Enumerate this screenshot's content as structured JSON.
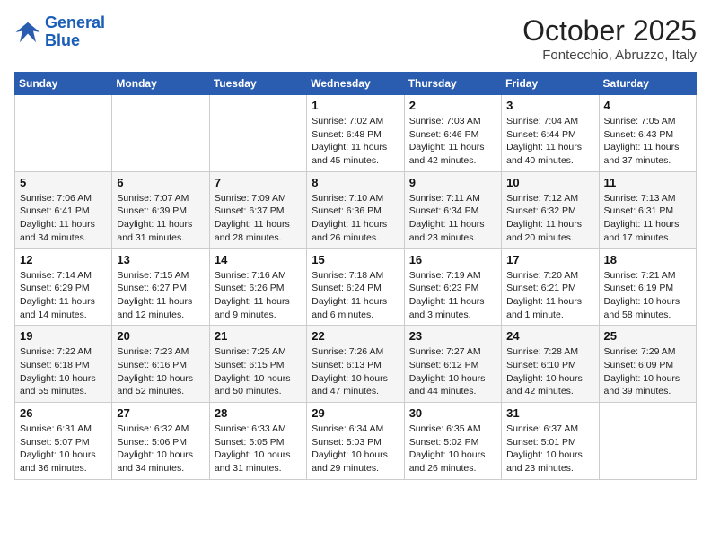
{
  "header": {
    "logo_line1": "General",
    "logo_line2": "Blue",
    "month": "October 2025",
    "location": "Fontecchio, Abruzzo, Italy"
  },
  "weekdays": [
    "Sunday",
    "Monday",
    "Tuesday",
    "Wednesday",
    "Thursday",
    "Friday",
    "Saturday"
  ],
  "weeks": [
    [
      {
        "day": "",
        "detail": ""
      },
      {
        "day": "",
        "detail": ""
      },
      {
        "day": "",
        "detail": ""
      },
      {
        "day": "1",
        "detail": "Sunrise: 7:02 AM\nSunset: 6:48 PM\nDaylight: 11 hours\nand 45 minutes."
      },
      {
        "day": "2",
        "detail": "Sunrise: 7:03 AM\nSunset: 6:46 PM\nDaylight: 11 hours\nand 42 minutes."
      },
      {
        "day": "3",
        "detail": "Sunrise: 7:04 AM\nSunset: 6:44 PM\nDaylight: 11 hours\nand 40 minutes."
      },
      {
        "day": "4",
        "detail": "Sunrise: 7:05 AM\nSunset: 6:43 PM\nDaylight: 11 hours\nand 37 minutes."
      }
    ],
    [
      {
        "day": "5",
        "detail": "Sunrise: 7:06 AM\nSunset: 6:41 PM\nDaylight: 11 hours\nand 34 minutes."
      },
      {
        "day": "6",
        "detail": "Sunrise: 7:07 AM\nSunset: 6:39 PM\nDaylight: 11 hours\nand 31 minutes."
      },
      {
        "day": "7",
        "detail": "Sunrise: 7:09 AM\nSunset: 6:37 PM\nDaylight: 11 hours\nand 28 minutes."
      },
      {
        "day": "8",
        "detail": "Sunrise: 7:10 AM\nSunset: 6:36 PM\nDaylight: 11 hours\nand 26 minutes."
      },
      {
        "day": "9",
        "detail": "Sunrise: 7:11 AM\nSunset: 6:34 PM\nDaylight: 11 hours\nand 23 minutes."
      },
      {
        "day": "10",
        "detail": "Sunrise: 7:12 AM\nSunset: 6:32 PM\nDaylight: 11 hours\nand 20 minutes."
      },
      {
        "day": "11",
        "detail": "Sunrise: 7:13 AM\nSunset: 6:31 PM\nDaylight: 11 hours\nand 17 minutes."
      }
    ],
    [
      {
        "day": "12",
        "detail": "Sunrise: 7:14 AM\nSunset: 6:29 PM\nDaylight: 11 hours\nand 14 minutes."
      },
      {
        "day": "13",
        "detail": "Sunrise: 7:15 AM\nSunset: 6:27 PM\nDaylight: 11 hours\nand 12 minutes."
      },
      {
        "day": "14",
        "detail": "Sunrise: 7:16 AM\nSunset: 6:26 PM\nDaylight: 11 hours\nand 9 minutes."
      },
      {
        "day": "15",
        "detail": "Sunrise: 7:18 AM\nSunset: 6:24 PM\nDaylight: 11 hours\nand 6 minutes."
      },
      {
        "day": "16",
        "detail": "Sunrise: 7:19 AM\nSunset: 6:23 PM\nDaylight: 11 hours\nand 3 minutes."
      },
      {
        "day": "17",
        "detail": "Sunrise: 7:20 AM\nSunset: 6:21 PM\nDaylight: 11 hours\nand 1 minute."
      },
      {
        "day": "18",
        "detail": "Sunrise: 7:21 AM\nSunset: 6:19 PM\nDaylight: 10 hours\nand 58 minutes."
      }
    ],
    [
      {
        "day": "19",
        "detail": "Sunrise: 7:22 AM\nSunset: 6:18 PM\nDaylight: 10 hours\nand 55 minutes."
      },
      {
        "day": "20",
        "detail": "Sunrise: 7:23 AM\nSunset: 6:16 PM\nDaylight: 10 hours\nand 52 minutes."
      },
      {
        "day": "21",
        "detail": "Sunrise: 7:25 AM\nSunset: 6:15 PM\nDaylight: 10 hours\nand 50 minutes."
      },
      {
        "day": "22",
        "detail": "Sunrise: 7:26 AM\nSunset: 6:13 PM\nDaylight: 10 hours\nand 47 minutes."
      },
      {
        "day": "23",
        "detail": "Sunrise: 7:27 AM\nSunset: 6:12 PM\nDaylight: 10 hours\nand 44 minutes."
      },
      {
        "day": "24",
        "detail": "Sunrise: 7:28 AM\nSunset: 6:10 PM\nDaylight: 10 hours\nand 42 minutes."
      },
      {
        "day": "25",
        "detail": "Sunrise: 7:29 AM\nSunset: 6:09 PM\nDaylight: 10 hours\nand 39 minutes."
      }
    ],
    [
      {
        "day": "26",
        "detail": "Sunrise: 6:31 AM\nSunset: 5:07 PM\nDaylight: 10 hours\nand 36 minutes."
      },
      {
        "day": "27",
        "detail": "Sunrise: 6:32 AM\nSunset: 5:06 PM\nDaylight: 10 hours\nand 34 minutes."
      },
      {
        "day": "28",
        "detail": "Sunrise: 6:33 AM\nSunset: 5:05 PM\nDaylight: 10 hours\nand 31 minutes."
      },
      {
        "day": "29",
        "detail": "Sunrise: 6:34 AM\nSunset: 5:03 PM\nDaylight: 10 hours\nand 29 minutes."
      },
      {
        "day": "30",
        "detail": "Sunrise: 6:35 AM\nSunset: 5:02 PM\nDaylight: 10 hours\nand 26 minutes."
      },
      {
        "day": "31",
        "detail": "Sunrise: 6:37 AM\nSunset: 5:01 PM\nDaylight: 10 hours\nand 23 minutes."
      },
      {
        "day": "",
        "detail": ""
      }
    ]
  ]
}
